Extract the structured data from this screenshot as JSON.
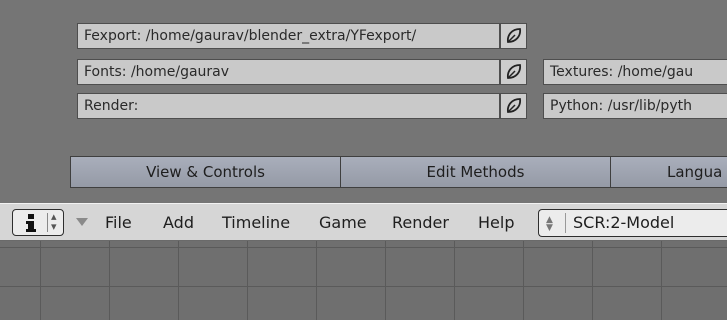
{
  "paths": {
    "fexport": "Fexport: /home/gaurav/blender_extra/YFexport/",
    "fonts": "Fonts: /home/gaurav",
    "render": "Render:",
    "textures": "Textures: /home/gau",
    "python": "Python: /usr/lib/pyth"
  },
  "icons": {
    "file_browse": "folder-leaf-icon",
    "editor_type": "info-icon"
  },
  "tabs": [
    "View & Controls",
    "Edit Methods",
    "Langua"
  ],
  "menu": {
    "items": [
      "File",
      "Add",
      "Timeline",
      "Game",
      "Render",
      "Help"
    ],
    "screen": "SCR:2-Model"
  },
  "colors": {
    "tab_accent": "#a3a8b5",
    "header_bg": "#d6d6d6",
    "panel_bg": "#757575"
  }
}
